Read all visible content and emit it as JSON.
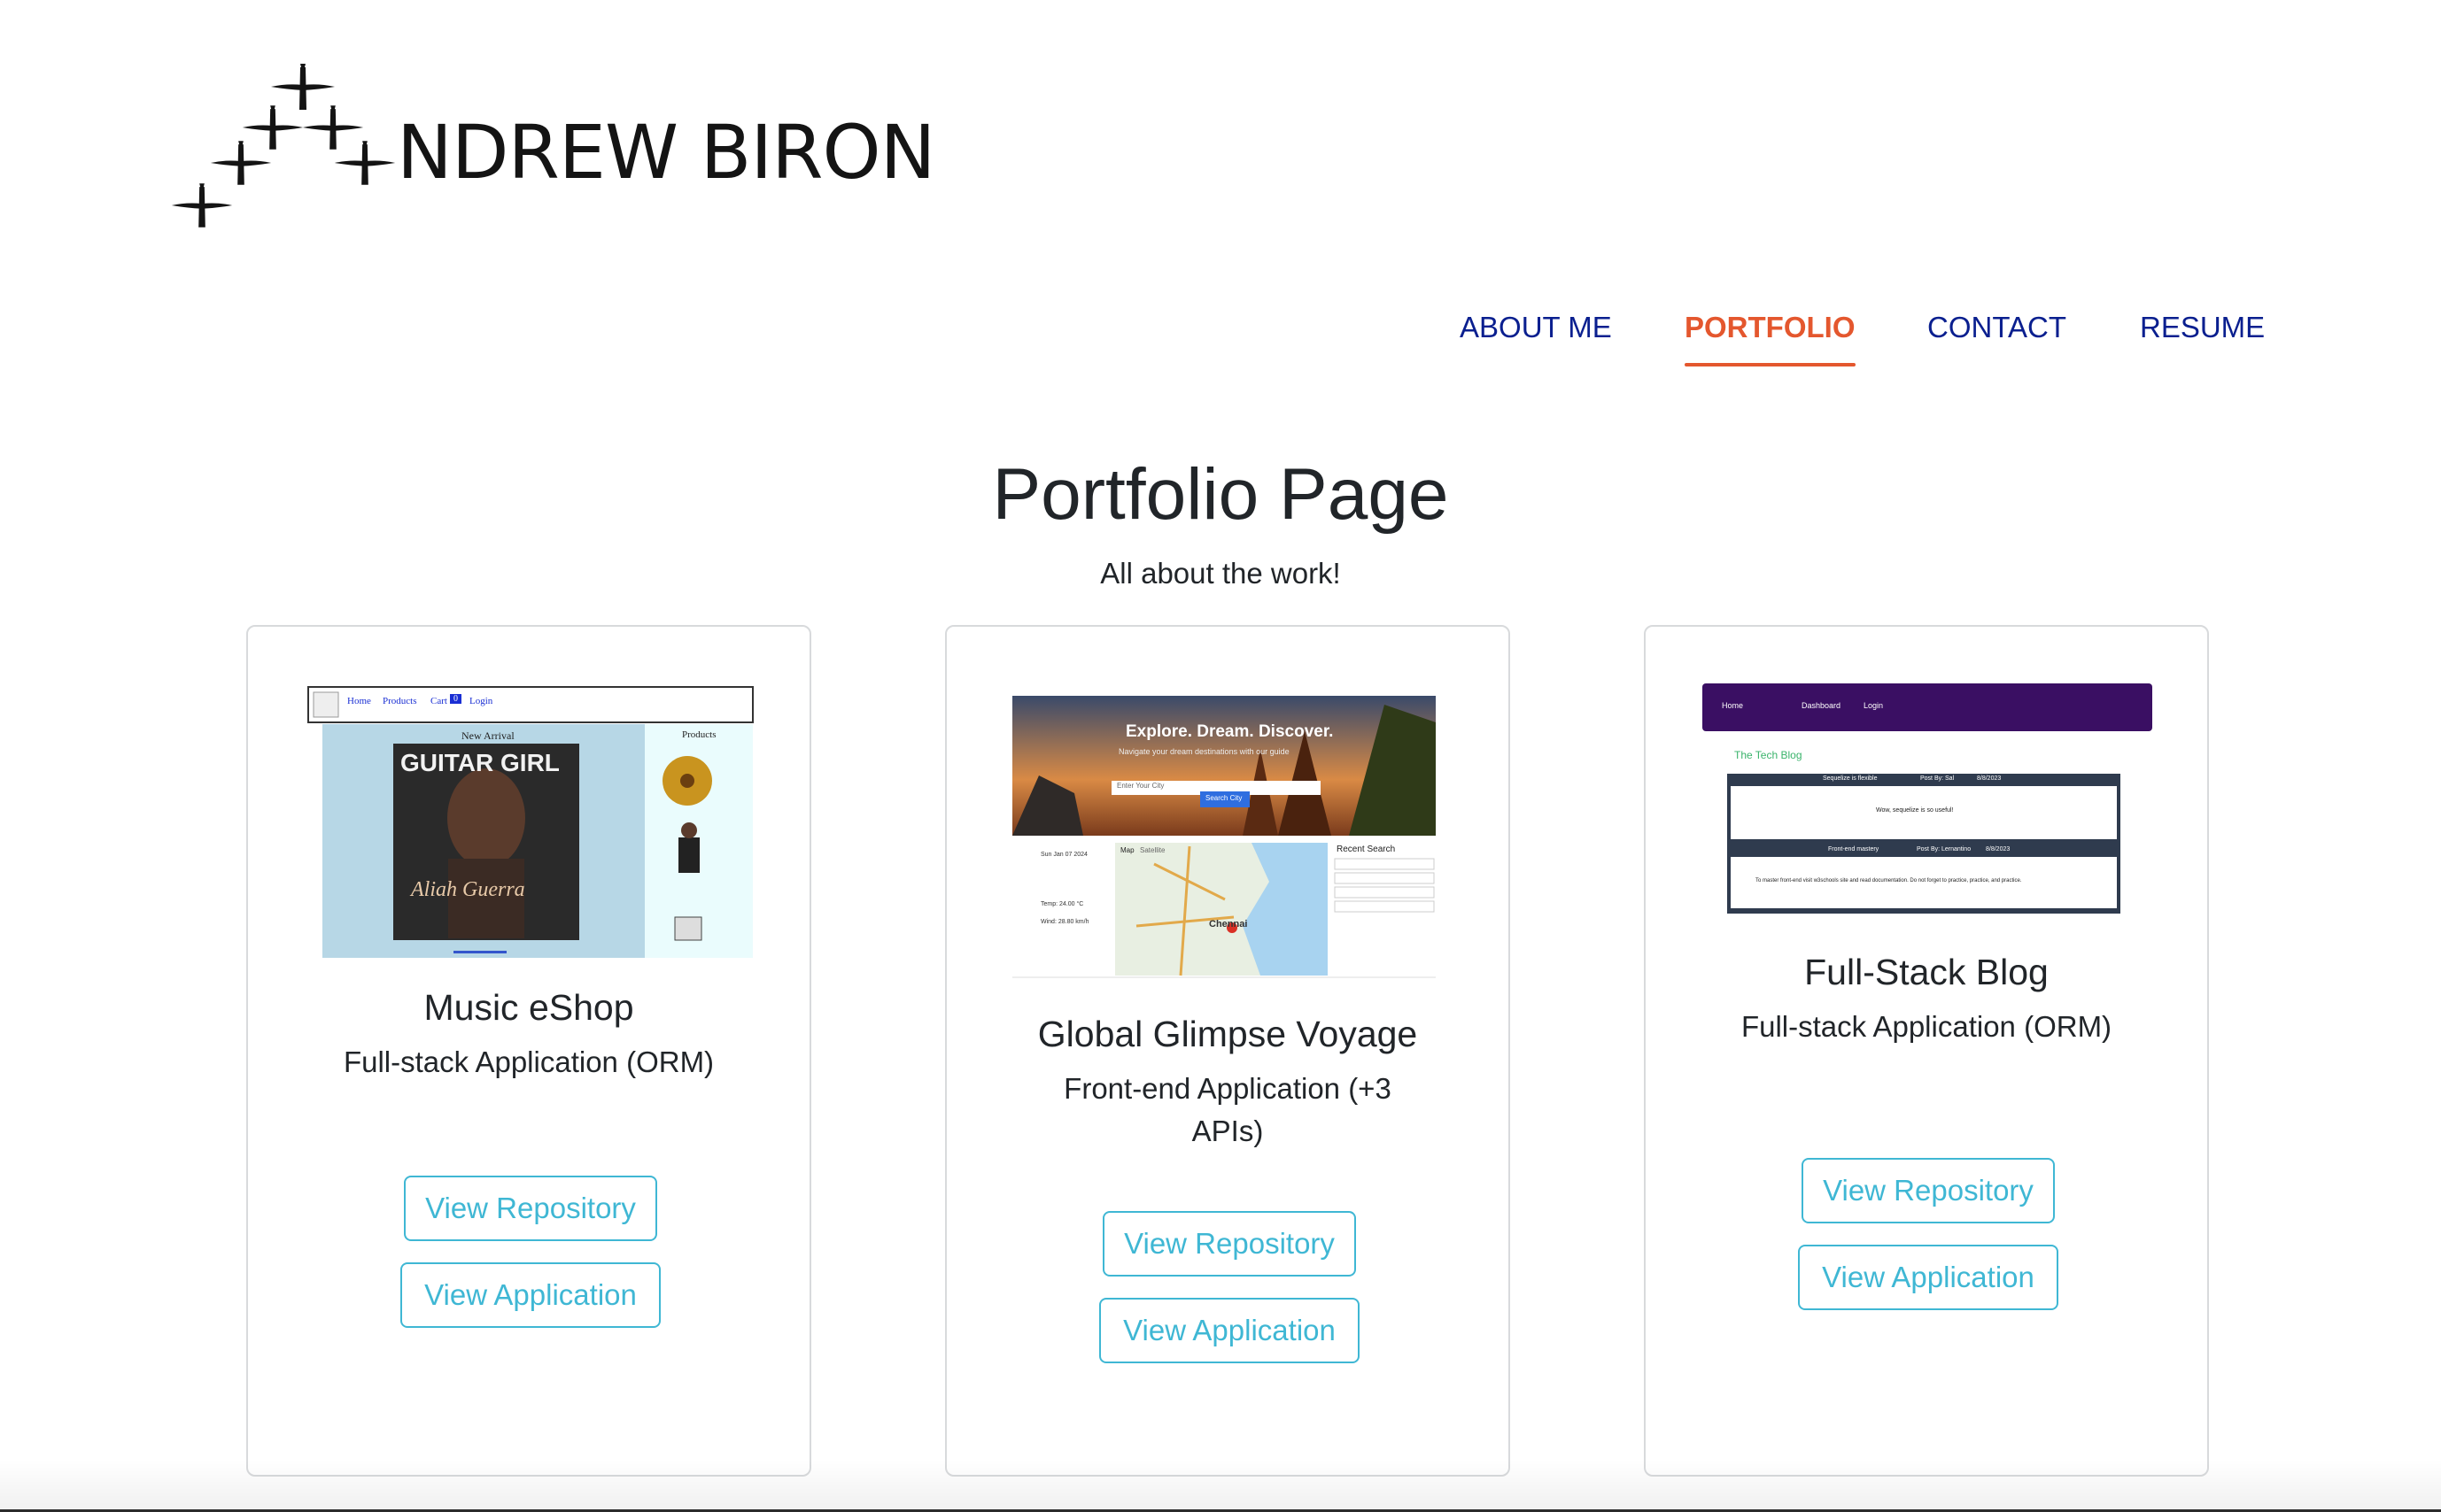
{
  "logo": {
    "text": "NDREW BIRON",
    "icon": "flying-birds-icon"
  },
  "nav": {
    "items": [
      {
        "label": "ABOUT ME"
      },
      {
        "label": "PORTFOLIO"
      },
      {
        "label": "CONTACT"
      },
      {
        "label": "RESUME"
      }
    ],
    "active": "PORTFOLIO"
  },
  "page": {
    "title": "Portfolio Page",
    "subtitle": "All about the work!"
  },
  "projects": [
    {
      "title": "Music eShop",
      "description": "Full-stack Application (ORM)",
      "repo_label": "View Repository",
      "app_label": "View Application",
      "thumb": {
        "nav": [
          "Home",
          "Products",
          "Cart",
          "Login"
        ],
        "cart_count": "0",
        "new_arrival": "New Arrival",
        "products": "Products",
        "magazine": "GUITAR GIRL",
        "cover_name": "Aliah Guerra"
      }
    },
    {
      "title": "Global Glimpse Voyage",
      "description": "Front-end Application (+3 APIs)",
      "repo_label": "View Repository",
      "app_label": "View Application",
      "thumb": {
        "headline": "Explore. Dream. Discover.",
        "tagline": "Navigate your dream destinations with our guide",
        "input_placeholder": "Enter Your City",
        "search_button": "Search City",
        "recent": "Recent Search",
        "map_tabs": [
          "Map",
          "Satellite"
        ],
        "map_city": "Chennai",
        "weather": [
          "Sun Jan 07 2024",
          "Temp: 24.00 °C",
          "Wind: 28.80 km/h"
        ]
      }
    },
    {
      "title": "Full-Stack Blog",
      "description": "Full-stack Application (ORM)",
      "repo_label": "View Repository",
      "app_label": "View Application",
      "thumb": {
        "nav": [
          "Home",
          "Dashboard",
          "Login"
        ],
        "brand": "The Tech Blog",
        "post1_title": "Sequelize is flexible",
        "post1_author": "Post By: Sal",
        "post1_date": "8/8/2023",
        "post1_body": "Wow, sequelize is so useful!",
        "post2_title": "Front-end mastery",
        "post2_author": "Post By: Lernantino",
        "post2_date": "8/8/2023",
        "post2_body": "To master front-end visit w3schools site and read documentation. Do not forget to practice, practice, and practice."
      }
    }
  ],
  "colors": {
    "nav": "#0a1f8f",
    "active": "#e4572e",
    "button": "#3fb7d4",
    "blog_nav": "#3a0f63"
  }
}
